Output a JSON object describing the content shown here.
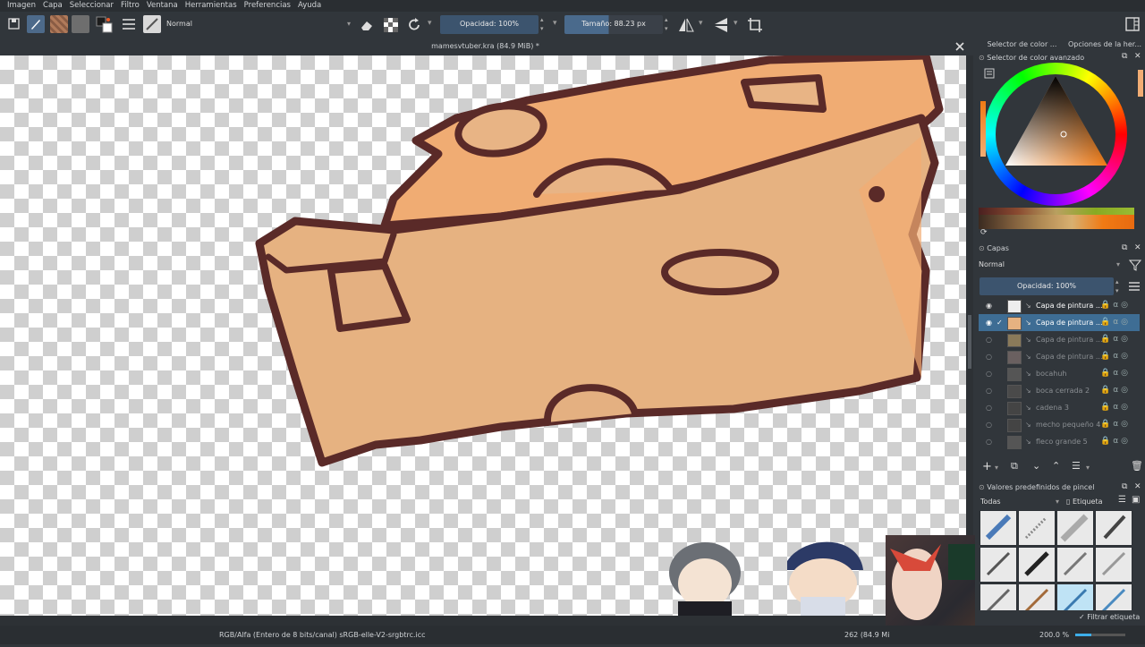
{
  "menu": [
    "Imagen",
    "Capa",
    "Seleccionar",
    "Filtro",
    "Ventana",
    "Herramientas",
    "Preferencias",
    "Ayuda"
  ],
  "toolbar": {
    "blend_mode": "Normal",
    "opacity": "Opacidad: 100%",
    "size_label": "Tamaño",
    "size_value": ": 88.23 px"
  },
  "document": {
    "tab_title": "mamesvtuber.kra (84.9 MiB) *"
  },
  "docker_tabs": [
    "Selector de color ...",
    "Opciones de la her..."
  ],
  "color_selector": {
    "title": "Selector de color avanzado"
  },
  "layers": {
    "title": "Capas",
    "blend_mode": "Normal",
    "opacity": "Opacidad: 100%",
    "items": [
      {
        "name": "Capa de pintura ...",
        "visible": true,
        "active": false
      },
      {
        "name": "Capa de pintura ...",
        "visible": true,
        "active": true
      },
      {
        "name": "Capa de pintura ...",
        "visible": false,
        "active": false
      },
      {
        "name": "Capa de pintura ...",
        "visible": false,
        "active": false
      },
      {
        "name": "bocahuh",
        "visible": false,
        "active": false
      },
      {
        "name": "boca cerrada 2",
        "visible": false,
        "active": false
      },
      {
        "name": "cadena 3",
        "visible": false,
        "active": false
      },
      {
        "name": "mecho pequeño 4",
        "visible": false,
        "active": false
      },
      {
        "name": "fleco grande 5",
        "visible": false,
        "active": false
      }
    ]
  },
  "brush_presets": {
    "title": "Valores predefinidos de pincel",
    "filter": "Todas",
    "tag": "Etiqueta",
    "filter_tag": "Filtrar etiqueta"
  },
  "status": {
    "color_space": "RGB/Alfa (Entero de 8 bits/canal)  sRGB-elle-V2-srgbtrc.icc",
    "memory": "262 (84.9 Mi",
    "zoom": "200.0 %"
  },
  "colors": {
    "accent": "#3daee9",
    "field": "#3c546e",
    "cheese": "#f2ab74",
    "outline": "#5a2a28",
    "panel": "#31363b"
  }
}
